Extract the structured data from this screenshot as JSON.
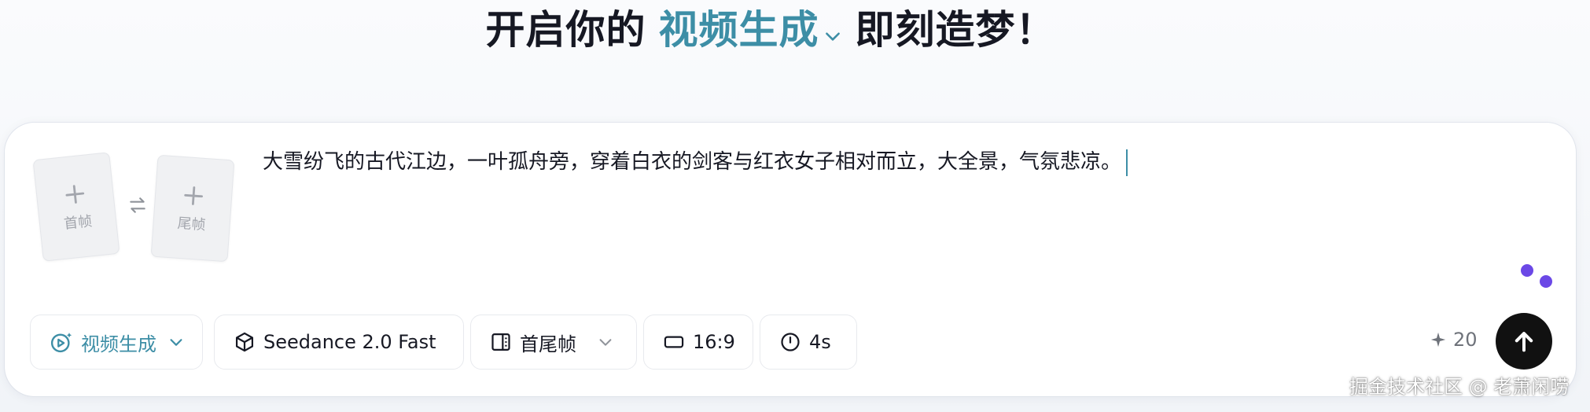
{
  "headline": {
    "prefix": "开启你的",
    "mode": "视频生成",
    "suffix": "即刻造梦！"
  },
  "frames": {
    "first_label": "首帧",
    "last_label": "尾帧"
  },
  "prompt": {
    "text": "大雪纷飞的古代江边，一叶孤舟旁，穿着白衣的剑客与红衣女子相对而立，大全景，气氛悲凉。"
  },
  "toolbar": {
    "mode_label": "视频生成",
    "model_label": "Seedance 2.0 Fast",
    "frame_mode_label": "首尾帧",
    "ratio_label": "16:9",
    "duration_label": "4s"
  },
  "credits": {
    "value": "20"
  },
  "watermark": {
    "text": "掘金技术社区 @ 老萧闲唠"
  },
  "colors": {
    "accent": "#3d8ea6",
    "send_button": "#111111",
    "loading_dots": "#6b48e6"
  },
  "icons": {
    "mode": "video-sparkle-icon",
    "model": "cube-icon",
    "frame": "first-last-frame-icon",
    "ratio": "aspect-ratio-icon",
    "duration": "clock-icon",
    "credits": "sparkle-icon",
    "send": "arrow-up-icon",
    "swap": "swap-arrows-icon"
  }
}
